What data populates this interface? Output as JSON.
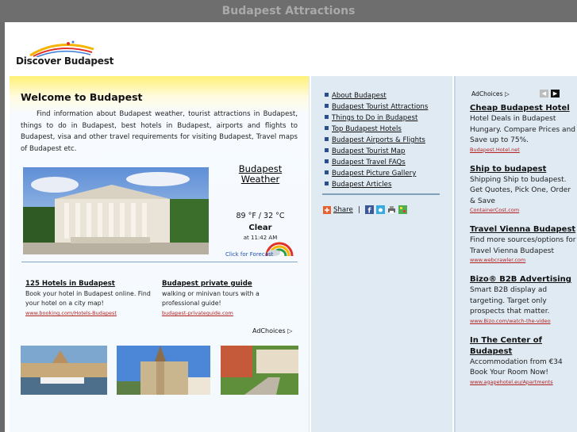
{
  "window": {
    "title": "Budapest Attractions"
  },
  "header": {
    "logo_text": "Discover Budapest"
  },
  "welcome": {
    "title": "Welcome to Budapest",
    "body": "Find information about Budapest weather, tourist attractions in Budapest, things to do in Budapest, best hotels in Budapest, airports and flights to Budapest, visa and other travel requirements for visiting Budapest, Travel maps of Budapest etc."
  },
  "weather": {
    "link": "Budapest Weather",
    "temp": "89 °F / 32 °C",
    "condition": "Clear",
    "time": "at 11:42 AM",
    "forecast_link": "Click for Forecast"
  },
  "left_ads": [
    {
      "title": "125 Hotels in Budapest",
      "body": "Book your hotel in Budapest online. Find your hotel on a city map!",
      "url": "www.booking.com/Hotels-Budapest"
    },
    {
      "title": "Budapest private guide",
      "body": "walking or minivan tours with a professional guide!",
      "url": "budapest-privateguide.com"
    }
  ],
  "adchoices_label": "AdChoices",
  "nav": {
    "items": [
      "About Budapest",
      "Budapest Tourist Attractions",
      "Things to Do in Budapest",
      "Top Budapest Hotels",
      "Budapest Airports & Flights",
      "Budapest Tourist Map",
      "Budapest Travel FAQs",
      "Budapest Picture Gallery",
      "Budapest Articles"
    ]
  },
  "share": {
    "label": "Share",
    "separator": "|"
  },
  "right_ads": [
    {
      "title": "Cheap Budapest Hotel",
      "body": "Hotel Deals in Budapest Hungary. Compare Prices and Save up to 75%.",
      "url": "Budapest.Hotel.net"
    },
    {
      "title": "Ship to budapest",
      "body": "Shipping Ship to budapest. Get Quotes, Pick One, Order & Save",
      "url": "ContainerCost.com"
    },
    {
      "title": "Travel Vienna Budapest",
      "body": "Find more sources/options for Travel Vienna Budapest",
      "url": "www.webcrawler.com"
    },
    {
      "title": "Bizo® B2B Advertising",
      "body": "Smart B2B display ad targeting. Target only prospects that matter.",
      "url": "www.Bizo.com/watch-the-video"
    },
    {
      "title": "In The Center of Budapest",
      "body": "Accommodation from €34 Book Your Room Now!",
      "url": "www.agapehotel.eu/Apartments"
    }
  ],
  "colors": {
    "accent_yellow": "#fff176",
    "panel_blue": "#dfeaf3",
    "link_red": "#b22222",
    "nav_bullet": "#2b4f8a"
  }
}
